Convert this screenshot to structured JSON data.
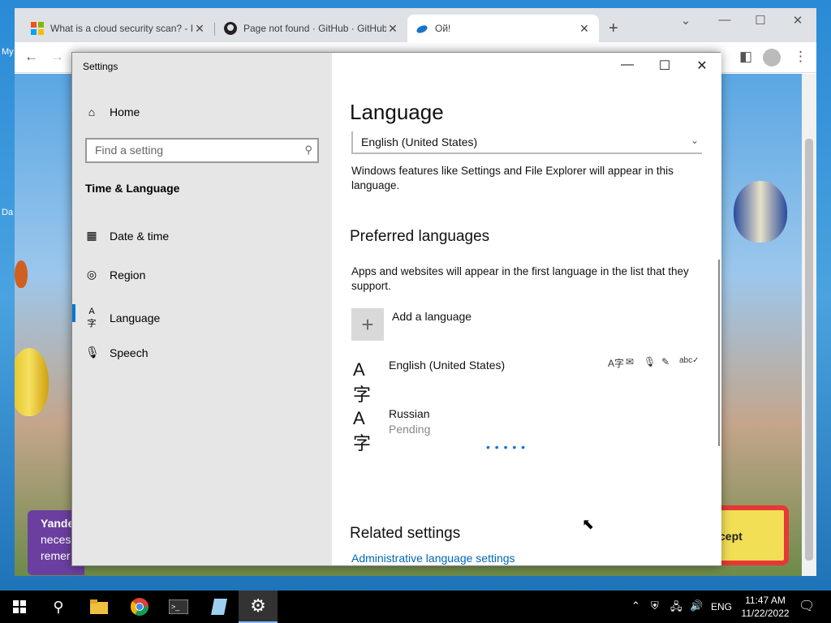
{
  "desktop": {
    "left_labels": [
      "My",
      "Da"
    ]
  },
  "browser": {
    "tabs": [
      {
        "title": "What is a cloud security scan? - I"
      },
      {
        "title": "Page not found · GitHub · GitHub"
      },
      {
        "title": "Ой!"
      }
    ],
    "new_tab_icon": "plus-icon",
    "cookie_banner": {
      "lines": [
        "Yande",
        "neces",
        "remer"
      ],
      "accept_label": "cept"
    }
  },
  "settings": {
    "window_title": "Settings",
    "controls": {
      "minimize": "—",
      "maximize": "☐",
      "close": "✕"
    },
    "nav": {
      "home": "Home",
      "search_placeholder": "Find a setting",
      "section": "Time & Language",
      "items": [
        {
          "label": "Date & time",
          "icon": "calendar-clock-icon"
        },
        {
          "label": "Region",
          "icon": "globe-icon"
        },
        {
          "label": "Language",
          "icon": "language-icon"
        },
        {
          "label": "Speech",
          "icon": "microphone-icon"
        }
      ],
      "selected": "Language"
    },
    "main": {
      "title": "Language",
      "display_language_value": "English (United States)",
      "display_language_desc": "Windows features like Settings and File Explorer will appear in this language.",
      "preferred_heading": "Preferred languages",
      "preferred_desc": "Apps and websites will appear in the first language in the list that they support.",
      "add_language_label": "Add a language",
      "languages": [
        {
          "name": "English (United States)",
          "status": ""
        },
        {
          "name": "Russian",
          "status": "Pending"
        }
      ],
      "feature_icons": [
        "A字",
        "✉",
        "🎙",
        "✎",
        "abc✓"
      ],
      "related_heading": "Related settings",
      "related_link": "Administrative language settings"
    }
  },
  "taskbar": {
    "lang": "ENG",
    "time": "11:47 AM",
    "date": "11/22/2022"
  },
  "colors": {
    "accent": "#0078d4",
    "taskbar": "#000000",
    "settings_nav_bg": "#e6e6e6"
  }
}
